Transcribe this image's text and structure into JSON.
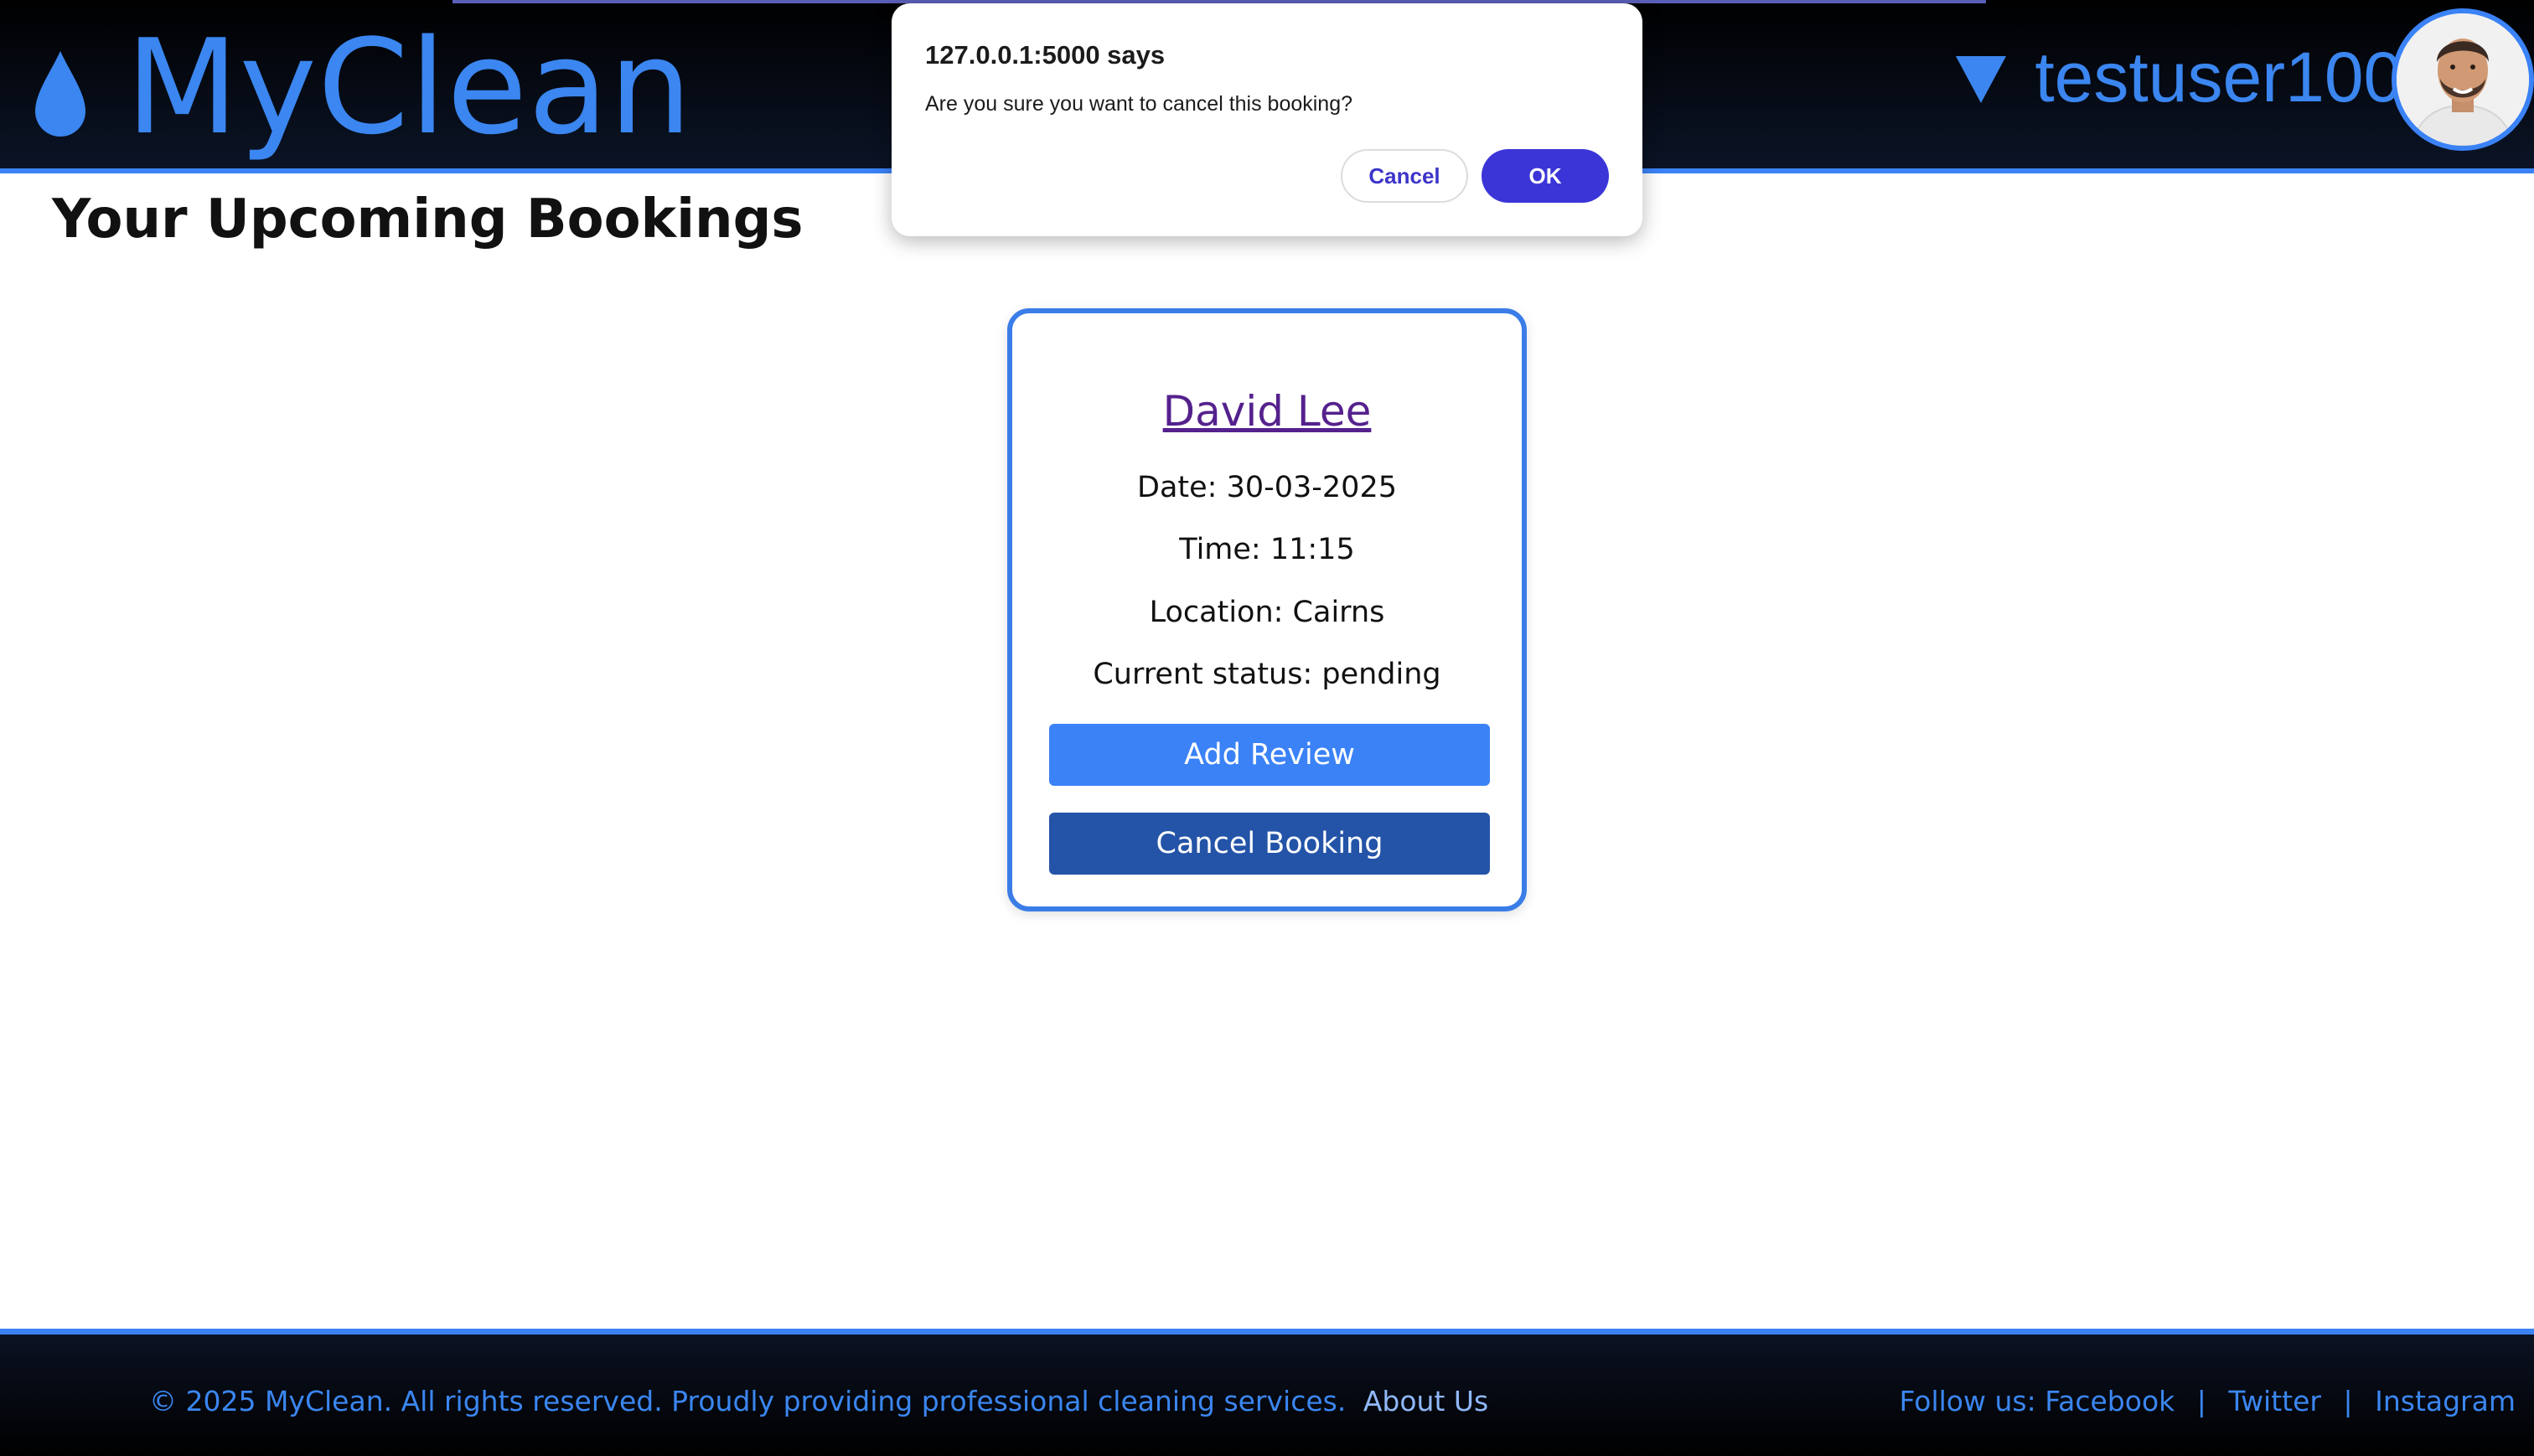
{
  "header": {
    "logo_text": "MyClean",
    "username": "testuser1000",
    "accent_color": "#3b82f6"
  },
  "main": {
    "page_title": "Your Upcoming Bookings"
  },
  "booking": {
    "cleaner_name": "David Lee",
    "date_line": "Date: 30-03-2025",
    "time_line": "Time: 11:15",
    "location_line": "Location: Cairns",
    "status_line": "Current status: pending",
    "add_review_label": "Add Review",
    "cancel_booking_label": "Cancel Booking"
  },
  "footer": {
    "copyright": "© 2025 MyClean. All rights reserved. Proudly providing professional cleaning services.",
    "about_link": "About Us",
    "follow_prefix": "Follow us:",
    "facebook": "Facebook",
    "separator": "|",
    "twitter": "Twitter",
    "instagram": "Instagram"
  },
  "dialog": {
    "origin": "127.0.0.1:5000 says",
    "message": "Are you sure you want to cancel this booking?",
    "cancel_label": "Cancel",
    "ok_label": "OK"
  },
  "icons": {
    "logo": "water-drop-icon",
    "user_menu": "caret-down-icon",
    "avatar": "user-avatar"
  }
}
